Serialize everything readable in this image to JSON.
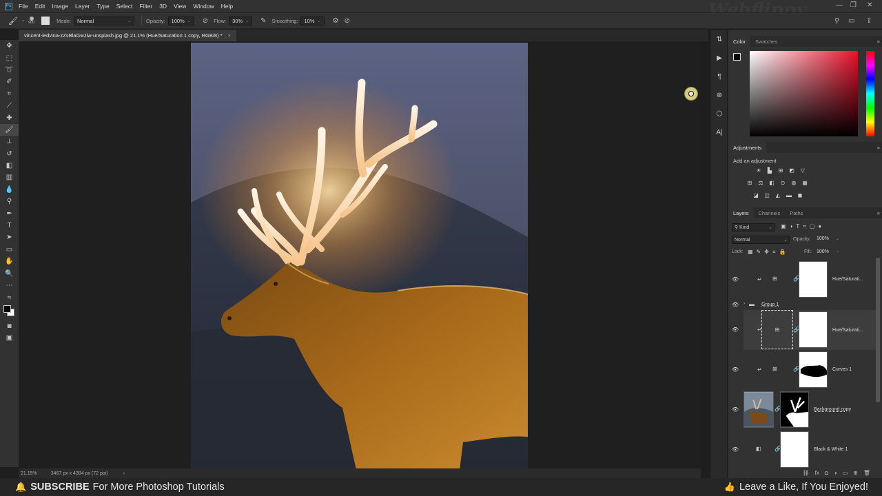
{
  "menubar": {
    "app_icon": "Ps",
    "items": [
      "File",
      "Edit",
      "Image",
      "Layer",
      "Type",
      "Select",
      "Filter",
      "3D",
      "View",
      "Window",
      "Help"
    ],
    "brand": "Webflippy"
  },
  "options": {
    "brush_size": "900",
    "mode_label": "Mode:",
    "mode_value": "Normal",
    "opacity_label": "Opacity:",
    "opacity_value": "100%",
    "flow_label": "Flow:",
    "flow_value": "30%",
    "smoothing_label": "Smoothing:",
    "smoothing_value": "10%"
  },
  "document": {
    "tab_title": "vincent-ledvina-zZsBlaGwJiw-unsplash.jpg @ 21.1% (Hue/Saturation 1 copy, RGB/8) *",
    "close": "×"
  },
  "status": {
    "zoom": "21.15%",
    "dimensions": "3467 px x 4384 px (72 ppi)",
    "arrow": "›"
  },
  "color_panel": {
    "tabs": [
      "Color",
      "Swatches"
    ],
    "foreground": "#000000",
    "background": "#ffffff"
  },
  "adjustments": {
    "title": "Adjustments",
    "subtitle": "Add an adjustment"
  },
  "layers_panel": {
    "tabs": [
      "Layers",
      "Channels",
      "Paths"
    ],
    "filter_kind": "Kind",
    "blend_mode": "Normal",
    "opacity_label": "Opacity:",
    "opacity_value": "100%",
    "lock_label": "Lock:",
    "fill_label": "Fill:",
    "fill_value": "100%",
    "layers": [
      {
        "name": "Hue/Saturati..."
      },
      {
        "name": "Group 1"
      },
      {
        "name": "Hue/Saturati..."
      },
      {
        "name": "Curves 1"
      },
      {
        "name": "Background copy"
      },
      {
        "name": "Black & White 1"
      }
    ]
  },
  "banner": {
    "subscribe": "SUBSCRIBE",
    "subscribe_rest": "For More Photoshop Tutorials",
    "like": "Leave a Like, If You Enjoyed!"
  }
}
